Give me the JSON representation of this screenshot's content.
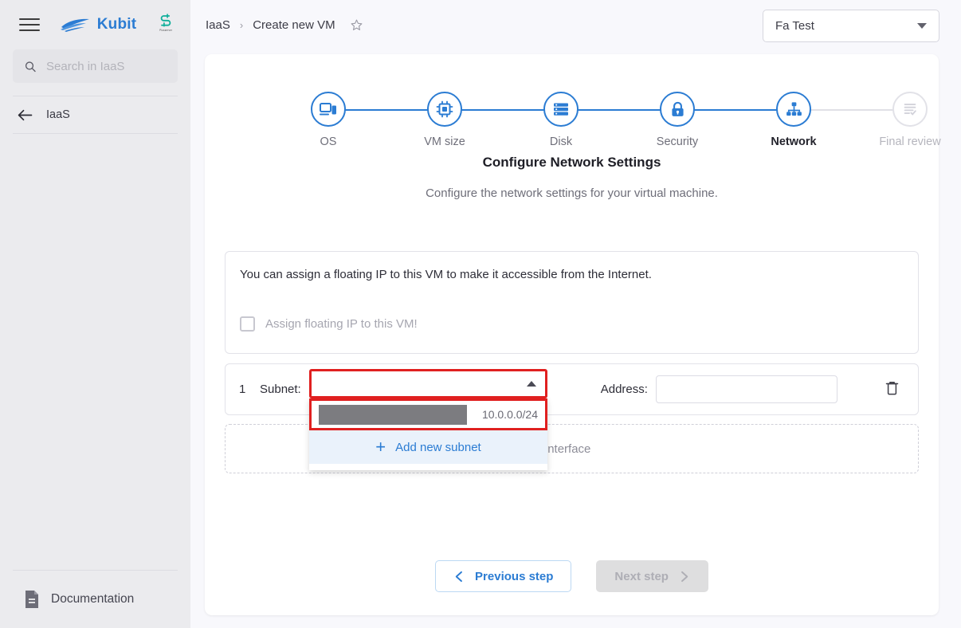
{
  "sidebar": {
    "menu_icon": "hamburger-icon",
    "brand": {
      "name": "Kubit",
      "logo": "kubit-wave-logo"
    },
    "partner": {
      "logo": "partner-s-logo",
      "caption": "Plusserver"
    },
    "search": {
      "placeholder": "Search in IaaS",
      "value": "",
      "icon": "search-icon"
    },
    "nav": [
      {
        "label": "IaaS",
        "icon": "arrow-left-icon"
      }
    ],
    "documentation": {
      "label": "Documentation",
      "icon": "document-icon"
    }
  },
  "topbar": {
    "breadcrumb": [
      {
        "label": "IaaS"
      },
      {
        "label": "Create new VM"
      }
    ],
    "separator": "›",
    "favorite_icon": "star-icon",
    "project_select": {
      "value": "Fa Test",
      "icon": "chevron-down-icon"
    }
  },
  "wizard": {
    "steps": [
      {
        "label": "OS",
        "icon": "devices-icon",
        "state": "complete"
      },
      {
        "label": "VM size",
        "icon": "cpu-chip-icon",
        "state": "complete"
      },
      {
        "label": "Disk",
        "icon": "storage-icon",
        "state": "complete"
      },
      {
        "label": "Security",
        "icon": "lock-icon",
        "state": "complete"
      },
      {
        "label": "Network",
        "icon": "network-icon",
        "state": "active"
      },
      {
        "label": "Final review",
        "icon": "checklist-icon",
        "state": "upcoming"
      }
    ],
    "title": "Configure Network Settings",
    "subtitle": "Configure the network settings for your virtual machine."
  },
  "floating_ip": {
    "description": "You can assign a floating IP to this VM to make it accessible from the Internet.",
    "checkbox_label": "Assign floating IP to this VM!",
    "checked": false
  },
  "interfaces": {
    "rows": [
      {
        "number": "1",
        "subnet_label": "Subnet:",
        "subnet_value": "",
        "address_label": "Address:",
        "address_value": "",
        "address_placeholder": "",
        "delete_icon": "trash-icon"
      }
    ],
    "add_interface_label": "Add interface"
  },
  "subnet_dropdown": {
    "open": true,
    "caret_icon": "chevron-up-icon",
    "options": [
      {
        "name_redacted": true,
        "cidr": "10.0.0.0/24"
      }
    ],
    "add_option": {
      "label": "Add new subnet",
      "icon": "plus-icon"
    },
    "highlight_color": "#e02020"
  },
  "footer": {
    "previous": {
      "label": "Previous step",
      "icon": "chevron-left-icon",
      "disabled": false
    },
    "next": {
      "label": "Next step",
      "icon": "chevron-right-icon",
      "disabled": true
    }
  },
  "colors": {
    "accent": "#2b7cd3",
    "sidebar_bg": "#ebebee",
    "page_bg": "#f8f8fc",
    "highlight": "#e02020",
    "partner_green": "#0fae9a"
  }
}
